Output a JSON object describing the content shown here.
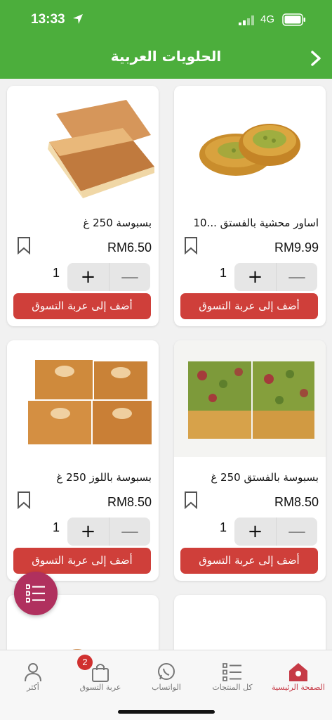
{
  "status_bar": {
    "time": "13:33",
    "network": "4G"
  },
  "header": {
    "title": "الحلويات العربية"
  },
  "products": [
    {
      "name": "اساور محشية بالفستق ...10",
      "price": "RM9.99",
      "qty": "1",
      "add_label": "أضف إلى عربة التسوق"
    },
    {
      "name": "بسبوسة  250 غ",
      "price": "RM6.50",
      "qty": "1",
      "add_label": "أضف إلى عربة التسوق"
    },
    {
      "name": "بسبوسة بالفستق 250 غ",
      "price": "RM8.50",
      "qty": "1",
      "add_label": "أضف إلى عربة التسوق"
    },
    {
      "name": "بسبوسة باللوز 250 غ",
      "price": "RM8.50",
      "qty": "1",
      "add_label": "أضف إلى عربة التسوق"
    }
  ],
  "stepper": {
    "plus": "+",
    "minus": "—"
  },
  "tabs": [
    {
      "label": "الصفحة الرئيسية",
      "icon": "home-icon",
      "active": true
    },
    {
      "label": "كل المنتجات",
      "icon": "list-icon"
    },
    {
      "label": "الواتساب",
      "icon": "whatsapp-icon"
    },
    {
      "label": "عربة التسوق",
      "icon": "cart-bag-icon",
      "badge": "2"
    },
    {
      "label": "أكثر",
      "icon": "person-icon"
    }
  ],
  "colors": {
    "brand_green": "#4cae3c",
    "add_red": "#cf3f3a",
    "fab": "#b0305e",
    "active_tab": "#c63a46"
  }
}
